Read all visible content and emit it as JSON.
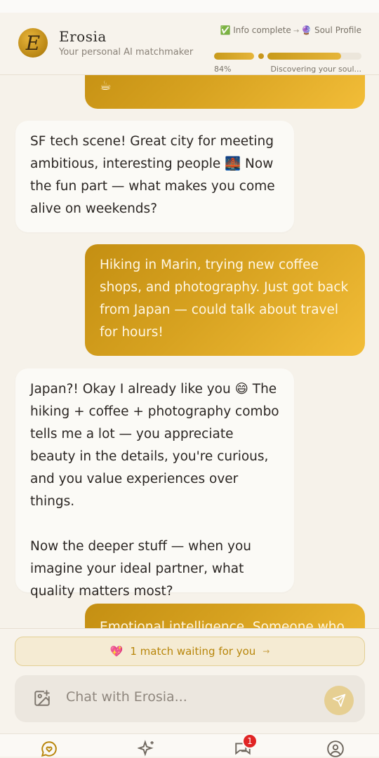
{
  "header": {
    "logo_letter": "E",
    "title": "Erosia",
    "subtitle": "Your personal AI matchmaker",
    "progress": {
      "step1": "✅ Info complete",
      "arrow": "→",
      "step2": "🔮 Soul Profile",
      "percent_label": "84%",
      "soul_fraction": 0.78,
      "status": "Discovering your soul..."
    }
  },
  "messages": [
    {
      "role": "user",
      "text": "☕"
    },
    {
      "role": "ai",
      "text": "SF tech scene! Great city for meeting ambitious, interesting people 🌉 Now the fun part — what makes you come alive on weekends?"
    },
    {
      "role": "user",
      "text": "Hiking in Marin, trying new coffee shops, and photography. Just got back from Japan — could talk about travel for hours!"
    },
    {
      "role": "ai",
      "text": "Japan?! Okay I already like you 😄 The hiking + coffee + photography combo tells me a lot — you appreciate beauty in the details, you're curious, and you value experiences over things.\n\nNow the deeper stuff — when you imagine your ideal partner, what quality matters most?"
    },
    {
      "role": "user",
      "text": "Emotional intelligence. Someone who"
    }
  ],
  "match_banner": {
    "emoji": "💖",
    "text": "1 match waiting for you",
    "arrow": "→"
  },
  "composer": {
    "placeholder": "Chat with Erosia..."
  },
  "nav": {
    "messages_badge": "1"
  },
  "colors": {
    "accent": "#d4a020",
    "badge": "#e02424"
  }
}
